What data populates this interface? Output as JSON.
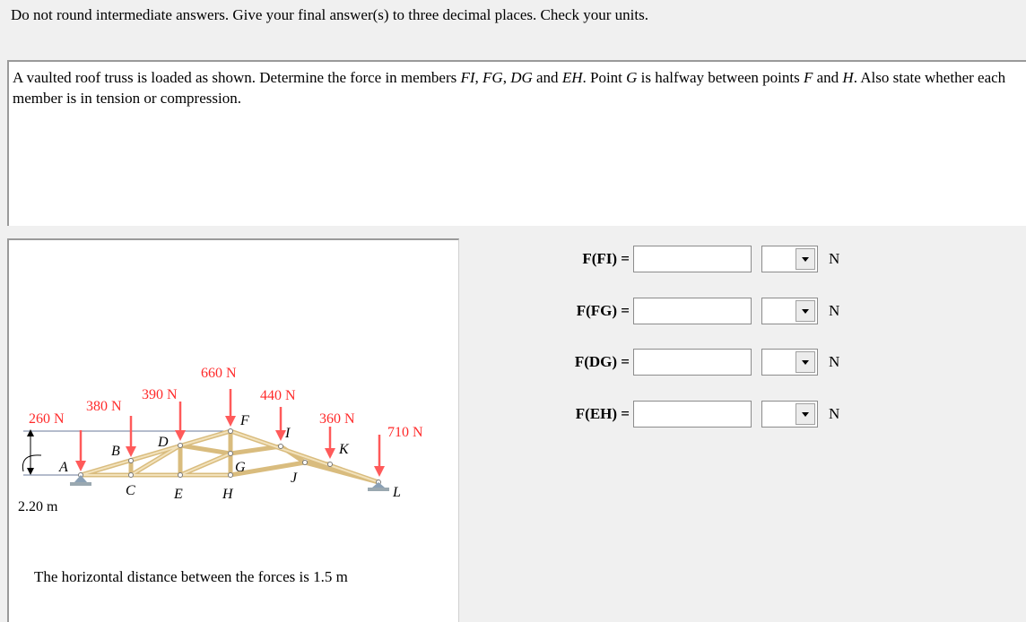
{
  "instructions": "Do not round intermediate answers.  Give your final answer(s) to three decimal places.  Check your units.",
  "problem": {
    "p1": "A vaulted roof truss is loaded as shown. Determine the force in members ",
    "m1": "FI",
    "p2": ", ",
    "m2": "FG",
    "p3": ", ",
    "m3": "DG",
    "p4": " and ",
    "m4": "EH",
    "p5": ".  Point ",
    "m5": "G",
    "p6": " is halfway between points ",
    "m6": "F",
    "p7": " and ",
    "m7": "H",
    "p8": ".  Also state whether each member is in tension or compression."
  },
  "figure": {
    "loads": [
      "260 N",
      "380 N",
      "390 N",
      "660 N",
      "440 N",
      "360 N",
      "710 N"
    ],
    "nodes": {
      "A": "A",
      "B": "B",
      "C": "C",
      "D": "D",
      "E": "E",
      "F": "F",
      "G": "G",
      "H": "H",
      "I": "I",
      "J": "J",
      "K": "K",
      "L": "L"
    },
    "height": "2.20 m",
    "caption": "The horizontal distance between the forces is 1.5 m"
  },
  "answers": [
    {
      "label": "F(FI) =",
      "value": "",
      "selected": "",
      "unit": "N"
    },
    {
      "label": "F(FG) =",
      "value": "",
      "selected": "",
      "unit": "N"
    },
    {
      "label": "F(DG) =",
      "value": "",
      "selected": "",
      "unit": "N"
    },
    {
      "label": "F(EH) =",
      "value": "",
      "selected": "",
      "unit": "N"
    }
  ],
  "colors": {
    "load": "#ff3333",
    "wood": "#ecd8a6",
    "wood_edge": "#d4b878",
    "support": "#7a8fa3"
  }
}
